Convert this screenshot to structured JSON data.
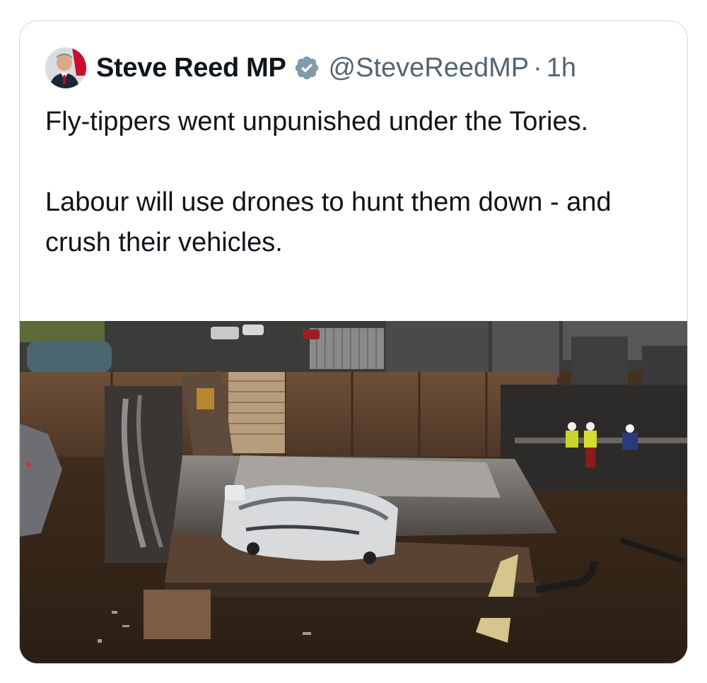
{
  "tweet": {
    "author": {
      "display_name": "Steve Reed MP",
      "handle": "@SteveReedMP",
      "verified": true,
      "separator": "·",
      "time": "1h"
    },
    "text": {
      "paragraph1": "Fly-tippers went unpunished under the Tories.",
      "paragraph2": "Labour will use drones to hunt them down - and crush their vehicles."
    },
    "media": {
      "type": "photo",
      "icon": "photo"
    }
  },
  "colors": {
    "verified_badge": "#829aab",
    "secondary_text": "#536471",
    "primary_text": "#0f1419",
    "card_border": "#cfd9de"
  }
}
